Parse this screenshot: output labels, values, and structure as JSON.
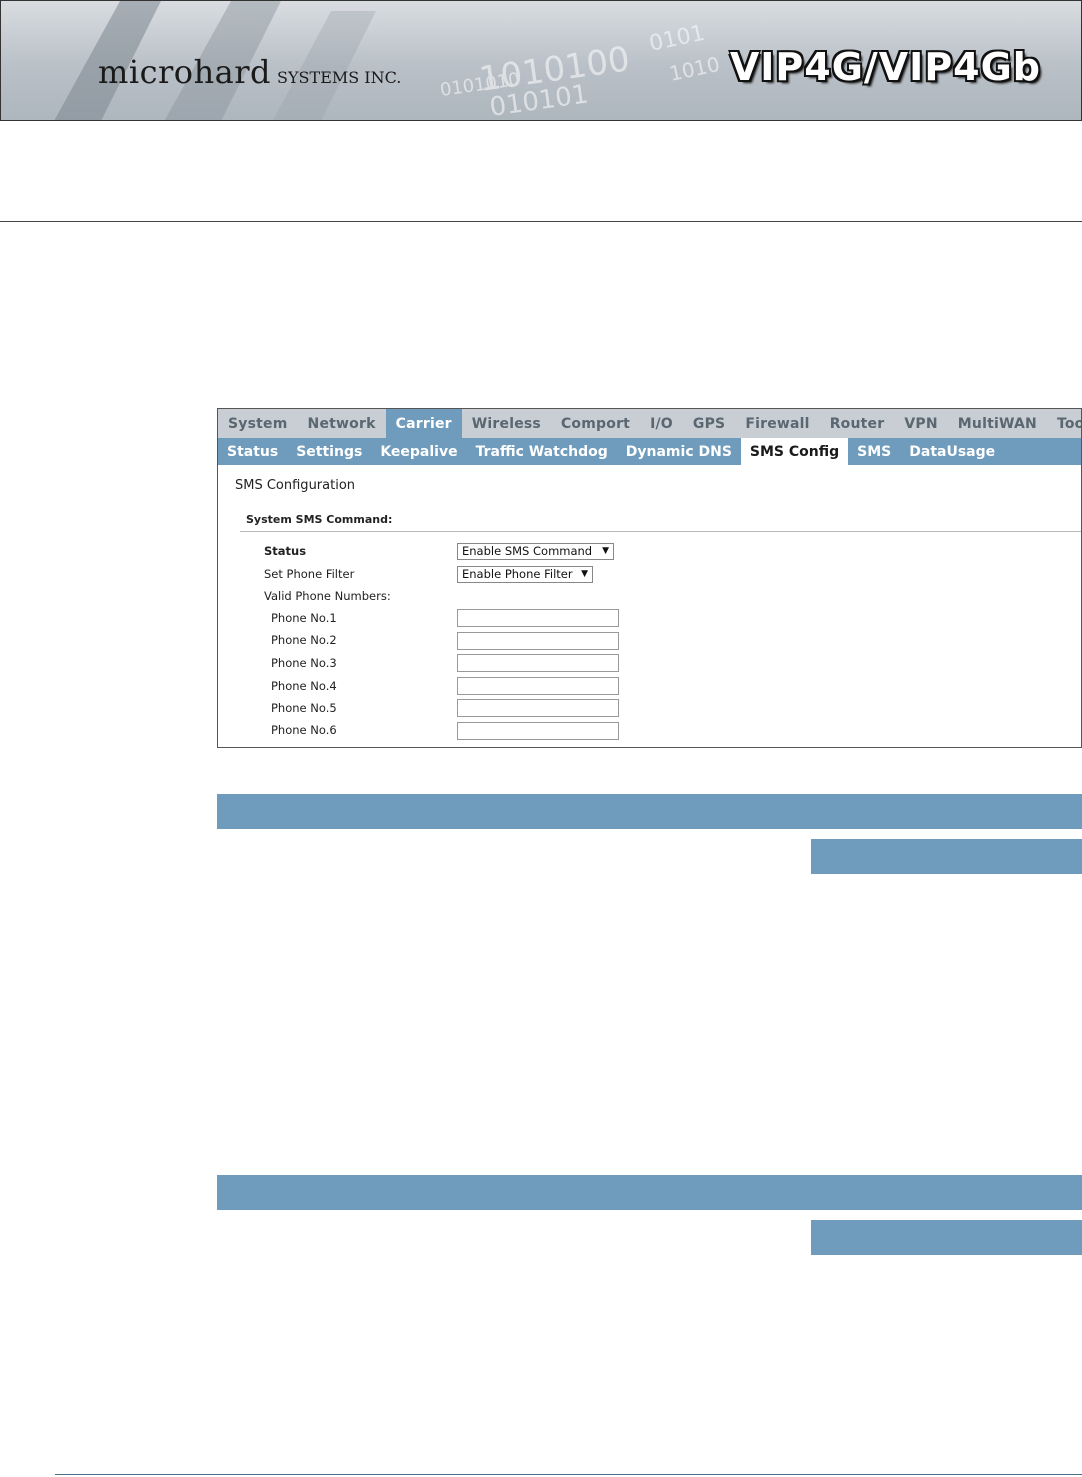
{
  "header": {
    "brand": "microhard",
    "brand_suffix": "SYSTEMS INC.",
    "product": "VIP4G/VIP4Gb"
  },
  "panel": {
    "nav_main": [
      "System",
      "Network",
      "Carrier",
      "Wireless",
      "Comport",
      "I/O",
      "GPS",
      "Firewall",
      "Router",
      "VPN",
      "MultiWAN",
      "Tools"
    ],
    "nav_main_active": "Carrier",
    "nav_sub": [
      "Status",
      "Settings",
      "Keepalive",
      "Traffic Watchdog",
      "Dynamic DNS",
      "SMS Config",
      "SMS",
      "DataUsage"
    ],
    "nav_sub_active": "SMS Config",
    "config_title": "SMS Configuration",
    "section_title": "System SMS Command:",
    "status_label": "Status",
    "status_value": "Enable SMS Command",
    "phone_filter_label": "Set Phone Filter",
    "phone_filter_value": "Enable Phone Filter",
    "valid_numbers_label": "Valid Phone Numbers:",
    "phones": [
      {
        "label": "Phone No.1",
        "value": ""
      },
      {
        "label": "Phone No.2",
        "value": ""
      },
      {
        "label": "Phone No.3",
        "value": ""
      },
      {
        "label": "Phone No.4",
        "value": ""
      },
      {
        "label": "Phone No.5",
        "value": ""
      },
      {
        "label": "Phone No.6",
        "value": ""
      }
    ]
  },
  "colors": {
    "accent_blue": "#6f9cbd",
    "nav_grey": "#c8ced4"
  }
}
